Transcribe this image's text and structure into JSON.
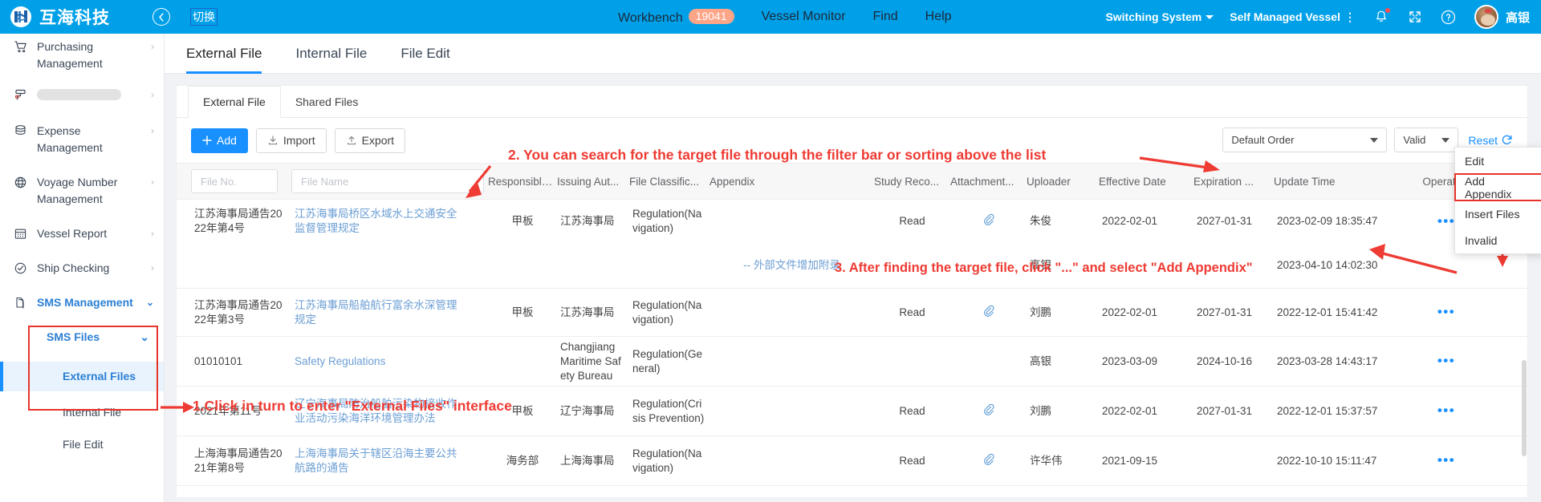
{
  "topbar": {
    "brand": "互海科技",
    "back_icon": "back-arrow-icon",
    "switch_label": "切换",
    "nav": [
      {
        "label": "Workbench",
        "badge": "19041"
      },
      {
        "label": "Vessel Monitor",
        "badge": ""
      },
      {
        "label": "Find",
        "badge": ""
      },
      {
        "label": "Help",
        "badge": ""
      }
    ],
    "switching_system": "Switching System",
    "self_managed_vessel": "Self Managed Vessel",
    "bell_icon": "bell-icon",
    "expand_icon": "expand-icon",
    "help_icon": "question-circle-icon",
    "user_name": "高银",
    "accent": "#00a0e9",
    "badge_color": "#ffa588"
  },
  "sidebar": {
    "items": [
      {
        "label": "Purchasing Management",
        "icon": "cart-icon",
        "arrow": "›",
        "type": "group"
      },
      {
        "label": "",
        "icon": "roller-icon",
        "arrow": "›",
        "type": "placeholder"
      },
      {
        "label": "Expense Management",
        "icon": "database-icon",
        "arrow": "›",
        "type": "group"
      },
      {
        "label": "Voyage Number Management",
        "icon": "globe-icon",
        "arrow": "›",
        "type": "group"
      },
      {
        "label": "Vessel Report",
        "icon": "calendar-icon",
        "arrow": "›",
        "type": "group"
      },
      {
        "label": "Ship Checking",
        "icon": "check-circle-icon",
        "arrow": "›",
        "type": "group"
      },
      {
        "label": "SMS Management",
        "icon": "files-icon",
        "arrow": "⌄",
        "type": "group-active"
      }
    ],
    "sms_files": "SMS Files",
    "sms_files_arrow": "⌄",
    "sub_items": [
      {
        "label": "External Files",
        "active": true
      },
      {
        "label": "Internal File",
        "active": false
      },
      {
        "label": "File Edit",
        "active": false
      }
    ]
  },
  "main": {
    "tabs": [
      {
        "label": "External File",
        "selected": true
      },
      {
        "label": "Internal File",
        "selected": false
      },
      {
        "label": "File Edit",
        "selected": false
      }
    ],
    "subtabs": [
      {
        "label": "External File",
        "selected": true
      },
      {
        "label": "Shared Files",
        "selected": false
      }
    ],
    "toolbar": {
      "add_label": "Add",
      "add_icon": "plus-icon",
      "import_label": "Import",
      "import_icon": "download-icon",
      "export_label": "Export",
      "export_icon": "upload-icon",
      "order_value": "Default Order",
      "status_value": "Valid",
      "reset_label": "Reset",
      "reset_icon": "refresh-icon"
    },
    "filters": {
      "file_no_placeholder": "File No.",
      "file_name_placeholder": "File Name"
    },
    "columns": [
      "File No.",
      "File Name",
      "Responsible ...",
      "Issuing Aut...",
      "File Classific...",
      "Appendix",
      "Study Reco...",
      "Attachment...",
      "Uploader",
      "Effective Date",
      "Expiration ...",
      "Update Time",
      "Operation"
    ],
    "rows": [
      {
        "file_no": "江苏海事局通告2022年第4号",
        "file_name": "江苏海事局桥区水域水上交通安全监督管理规定",
        "responsible": "甲板",
        "issuing": "江苏海事局",
        "classification": "Regulation(Navigation)",
        "appendix": "",
        "study": "Read",
        "attachment": "paperclip-icon",
        "uploader": "朱俊",
        "effective": "2022-02-01",
        "expiration": "2027-01-31",
        "update": "2023-02-09 18:35:47",
        "operation": "more-dots-icon"
      },
      {
        "file_no": "",
        "file_name": "",
        "responsible": "",
        "issuing": "",
        "classification": "",
        "appendix": "-- 外部文件增加附录",
        "study": "",
        "attachment": "",
        "uploader": "高银",
        "effective": "",
        "expiration": "",
        "update": "2023-04-10 14:02:30",
        "operation": ""
      },
      {
        "file_no": "江苏海事局通告2022年第3号",
        "file_name": "江苏海事局船舶航行富余水深管理规定",
        "responsible": "甲板",
        "issuing": "江苏海事局",
        "classification": "Regulation(Navigation)",
        "appendix": "",
        "study": "Read",
        "attachment": "paperclip-icon",
        "uploader": "刘鹏",
        "effective": "2022-02-01",
        "expiration": "2027-01-31",
        "update": "2022-12-01 15:41:42",
        "operation": "more-dots-icon"
      },
      {
        "file_no": "01010101",
        "file_name": "Safety Regulations",
        "responsible": "",
        "issuing": "Changjiang Maritime Safety Bureau",
        "classification": "Regulation(General)",
        "appendix": "",
        "study": "",
        "attachment": "",
        "uploader": "高银",
        "effective": "2023-03-09",
        "expiration": "2024-10-16",
        "update": "2023-03-28 14:43:17",
        "operation": "more-dots-icon"
      },
      {
        "file_no": "2021年第11号",
        "file_name": "辽宁海事局防治船舶污染物接收作业活动污染海洋环境管理办法",
        "responsible": "甲板",
        "issuing": "辽宁海事局",
        "classification": "Regulation(Crisis Prevention)",
        "appendix": "",
        "study": "Read",
        "attachment": "paperclip-icon",
        "uploader": "刘鹏",
        "effective": "2022-02-01",
        "expiration": "2027-01-31",
        "update": "2022-12-01 15:37:57",
        "operation": "more-dots-icon"
      },
      {
        "file_no": "上海海事局通告2021年第8号",
        "file_name": "上海海事局关于辖区沿海主要公共航路的通告",
        "responsible": "海务部",
        "issuing": "上海海事局",
        "classification": "Regulation(Navigation)",
        "appendix": "",
        "study": "Read",
        "attachment": "paperclip-icon",
        "uploader": "许华伟",
        "effective": "2021-09-15",
        "expiration": "",
        "update": "2022-10-10 15:11:47",
        "operation": "more-dots-icon"
      }
    ],
    "context_menu": [
      {
        "label": "Edit",
        "highlighted": false
      },
      {
        "label": "Add Appendix",
        "highlighted": true
      },
      {
        "label": "Insert Files",
        "highlighted": false
      },
      {
        "label": "Invalid",
        "highlighted": false
      }
    ]
  },
  "annotations": {
    "step1": "1.Click in turn to enter \"External Files\" interface",
    "step2": "2. You can search for the target file through the filter bar or sorting above the list",
    "step3": "3. After finding the target file, click \"...\" and select \"Add Appendix\"",
    "color": "#ee3b33"
  }
}
